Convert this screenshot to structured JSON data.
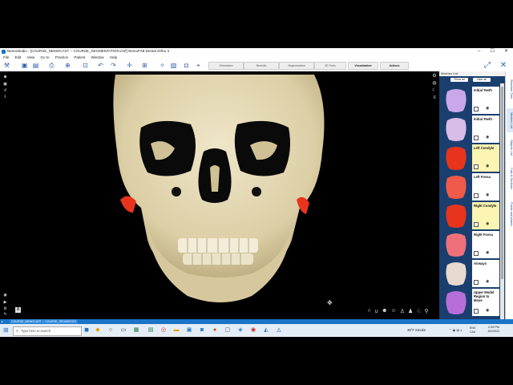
{
  "app": {
    "title": "NemoStudio - [COURSE_NEMOCAST -- COURSE_SEGMENTATION.nmf] NemoFAB Dental Ortho 3"
  },
  "menu": [
    "File",
    "Edit",
    "View",
    "Go to",
    "Practice",
    "Patient",
    "Window",
    "Help"
  ],
  "toolbar": {
    "buttons": [
      "Orientation",
      "Nemotic",
      "Segmentation",
      "3D Tools",
      "Visualization",
      "Actions"
    ]
  },
  "viewport": {
    "orientation_label": "A"
  },
  "panel": {
    "header": "Meshes List",
    "show_all": "Show all",
    "hide_all": "Hide all",
    "items": [
      {
        "name": "Initial Teeth",
        "highlighted": false,
        "thumb_color": "#c9a7e8"
      },
      {
        "name": "Initial Teeth",
        "highlighted": false,
        "thumb_color": "#d8bde9"
      },
      {
        "name": "Left Condyle",
        "highlighted": true,
        "thumb_color": "#e8341c"
      },
      {
        "name": "Left Fossa",
        "highlighted": false,
        "thumb_color": "#f05a4a"
      },
      {
        "name": "Right Condyle",
        "highlighted": true,
        "thumb_color": "#e8341c"
      },
      {
        "name": "Right Fossa",
        "highlighted": false,
        "thumb_color": "#f0707a"
      },
      {
        "name": "Airways",
        "highlighted": false,
        "thumb_color": "#e9d8cf"
      },
      {
        "name": "Upper Model Region to Move",
        "highlighted": false,
        "thumb_color": "#b86ed8"
      }
    ],
    "vertical_tabs": [
      "Structure Tree",
      "Meshes List",
      "Objects List",
      "Cuts & Sections",
      "Points and planes"
    ]
  },
  "status": {
    "tab": "COURSE_NEMOCAST -- COURSE_SEGMENTAT"
  },
  "taskbar": {
    "search_placeholder": "Type here to search",
    "weather": "39°F Smoke",
    "language": "ENG\nCAA",
    "time": "2:05 PM",
    "date": "8/2/2022"
  }
}
